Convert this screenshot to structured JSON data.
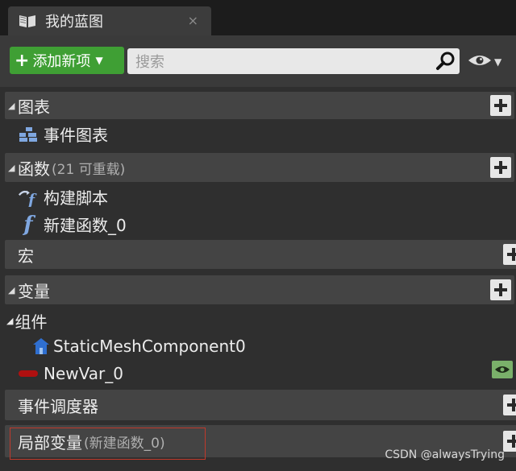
{
  "tab": {
    "title": "我的蓝图",
    "close": "×",
    "icon": "book-icon"
  },
  "toolbar": {
    "add_label": "添加新项",
    "search_placeholder": "搜索",
    "search_icon": "search-icon",
    "view_icon": "eye-icon"
  },
  "sections": {
    "graphs": {
      "label": "图表",
      "items": [
        {
          "label": "事件图表",
          "icon": "event-graph-icon"
        }
      ]
    },
    "functions": {
      "label": "函数",
      "sub": "(21 可重载)",
      "items": [
        {
          "label": "构建脚本",
          "icon": "construction-script-icon"
        },
        {
          "label": "新建函数_0",
          "icon": "function-icon"
        }
      ]
    },
    "macros": {
      "label": "宏"
    },
    "variables": {
      "label": "变量",
      "components_label": "组件",
      "component_item": "StaticMeshComponent0",
      "var_item": "NewVar_0"
    },
    "dispatchers": {
      "label": "事件调度器"
    },
    "local_vars": {
      "label": "局部变量",
      "sub": "(新建函数_0)"
    }
  },
  "colors": {
    "add_button": "#3f9f34",
    "highlight_border": "#c0392b",
    "function_icon": "#7fa7e0",
    "variable_pill": "#b01010"
  },
  "watermark": "CSDN @alwaysTrying"
}
